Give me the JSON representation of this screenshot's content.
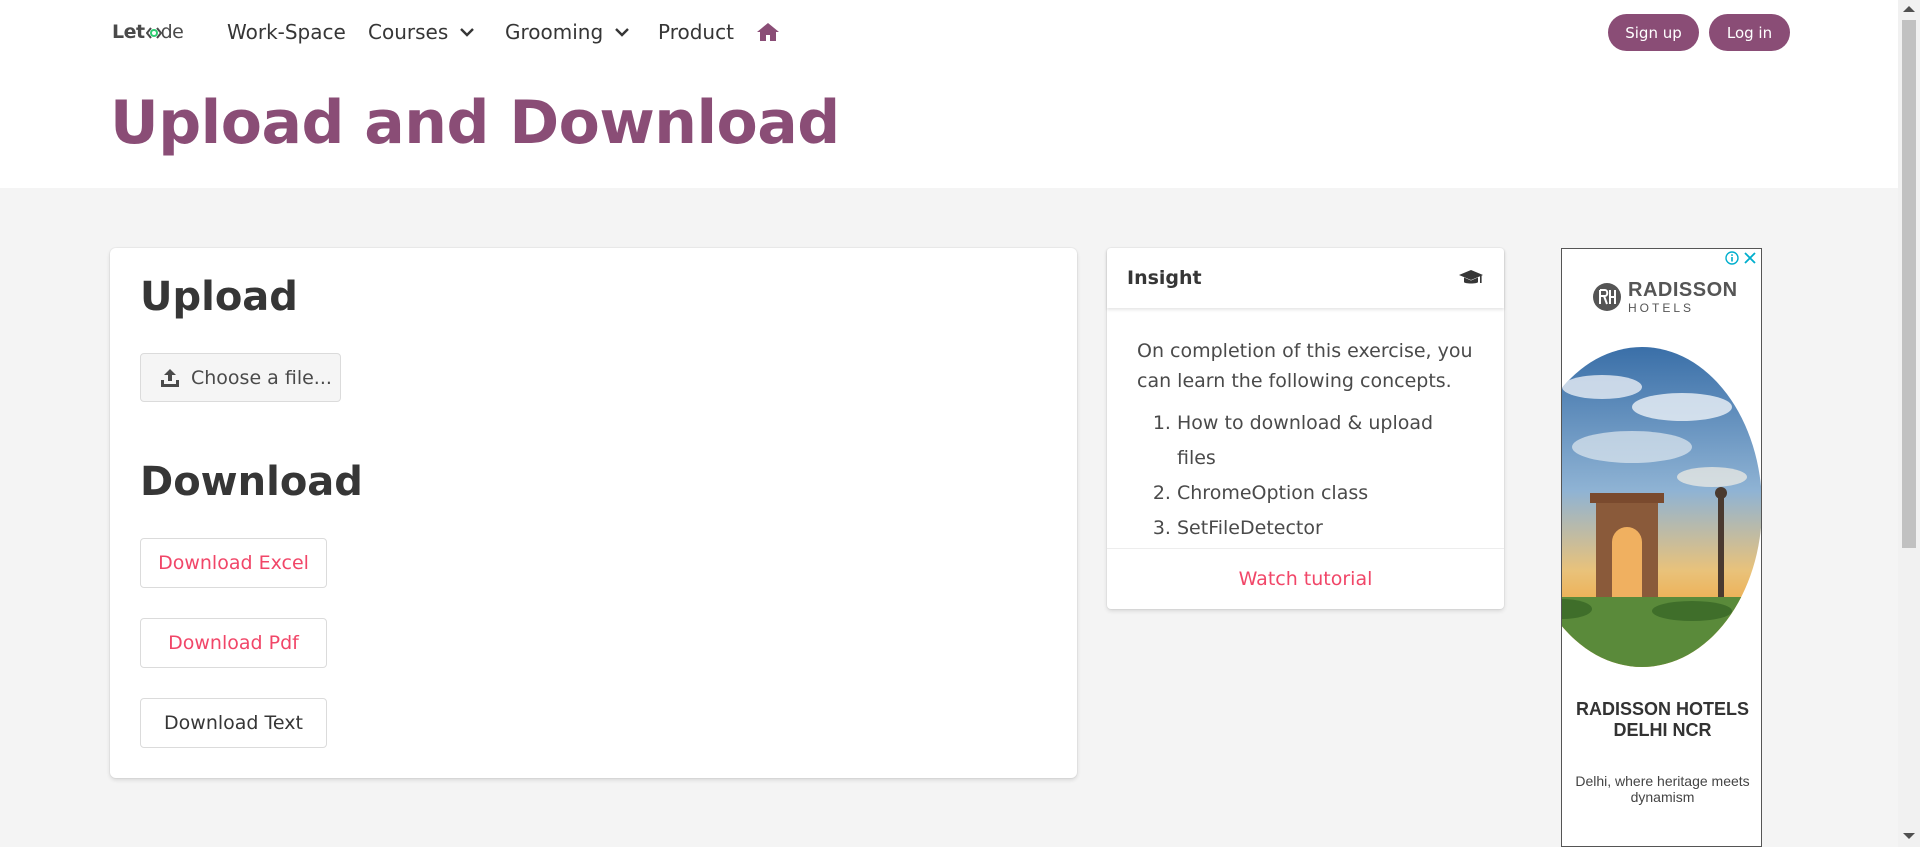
{
  "navbar": {
    "brand": {
      "part1": "Let",
      "part2": "de"
    },
    "items": [
      {
        "label": "Work-Space"
      },
      {
        "label": "Courses"
      },
      {
        "label": "Grooming"
      },
      {
        "label": "Product"
      }
    ],
    "signup_label": "Sign up",
    "login_label": "Log in"
  },
  "hero": {
    "title": "Upload and Download"
  },
  "upload": {
    "title": "Upload",
    "file_button_label": "Choose a file..."
  },
  "download": {
    "title": "Download",
    "buttons": [
      {
        "label": "Download Excel",
        "color": "#f14668"
      },
      {
        "label": "Download Pdf",
        "color": "#f14668"
      },
      {
        "label": "Download Text",
        "color": "#363636"
      }
    ]
  },
  "insight": {
    "title": "Insight",
    "intro": "On completion of this exercise, you can learn the following concepts.",
    "concepts": [
      "How to download & upload files",
      "ChromeOption class",
      "SetFileDetector"
    ],
    "footer_link": "Watch tutorial"
  },
  "ad": {
    "logo_line1": "RADISSON",
    "logo_line2": "HOTELS",
    "heading": "RADISSON HOTELS DELHI NCR",
    "subtext": "Delhi, where heritage meets dynamism"
  },
  "colors": {
    "brand": "#8a4d76",
    "accent": "#f14668",
    "background": "#f4f4f4"
  }
}
